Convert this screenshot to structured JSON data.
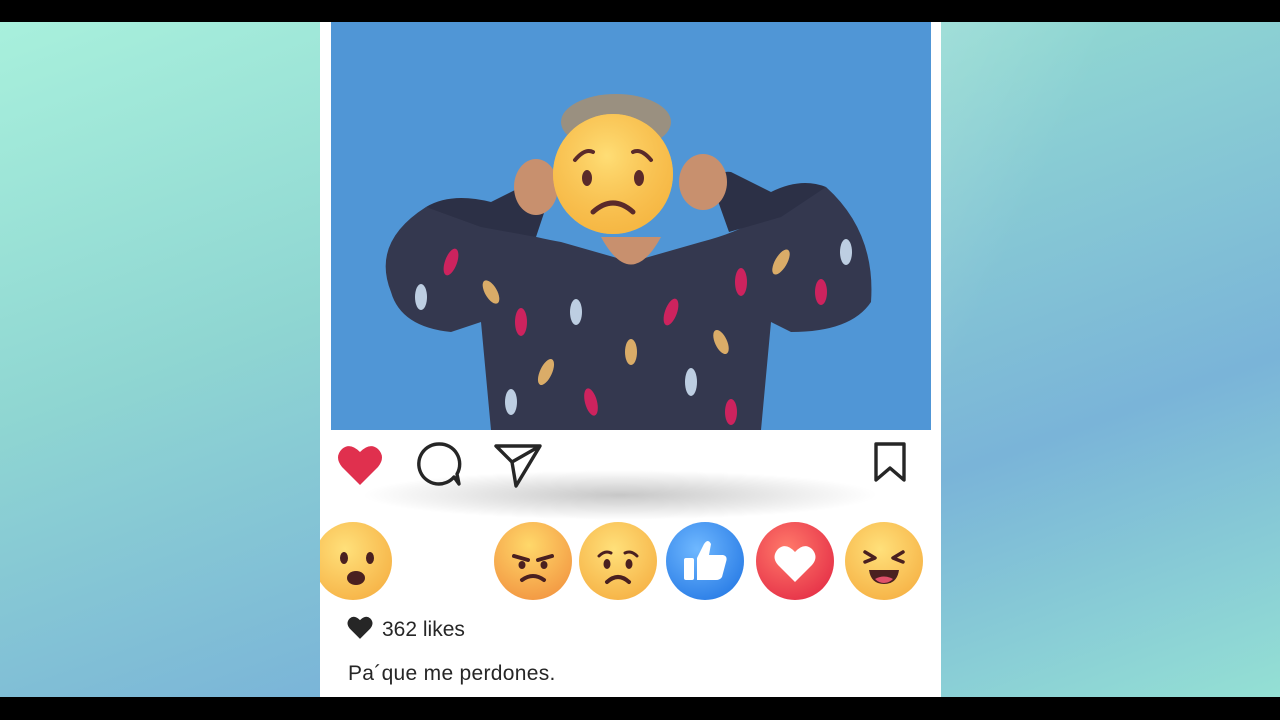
{
  "post": {
    "likes_text": "362 likes",
    "caption": "Pa´que me perdones."
  },
  "icons": {
    "like": "heart-icon",
    "comment": "comment-icon",
    "share": "paper-plane-icon",
    "save": "bookmark-icon",
    "likes": "heart-icon"
  },
  "reactions": [
    "wow",
    "angry",
    "sad",
    "like",
    "love",
    "haha"
  ],
  "colors": {
    "photo_background": "#5096d6",
    "like_red": "#e0304e",
    "reaction_like_blue": "#2f8ff0",
    "reaction_love_red": "#f0354a",
    "emoji_yellow": "#fbc84a",
    "text": "#262626"
  }
}
